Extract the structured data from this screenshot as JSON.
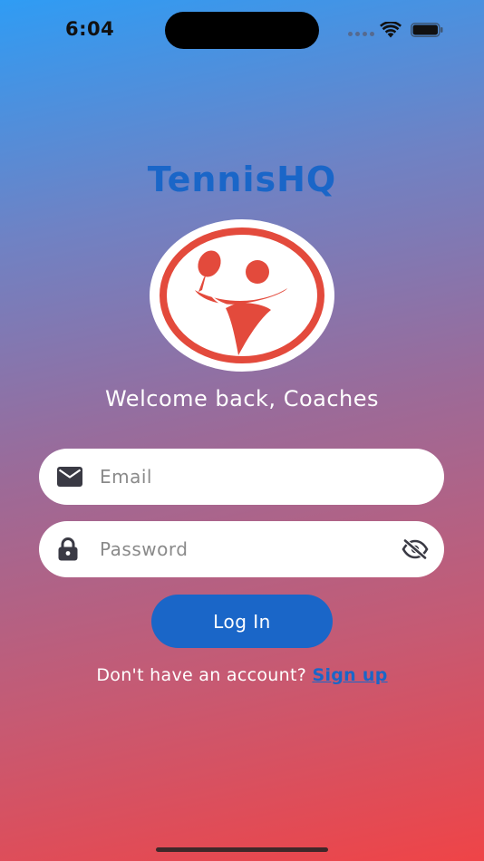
{
  "status_bar": {
    "time": "6:04"
  },
  "app": {
    "title": "TennisHQ",
    "welcome": "Welcome back, Coaches"
  },
  "form": {
    "email_placeholder": "Email",
    "email_value": "",
    "password_placeholder": "Password",
    "password_value": "",
    "login_label": "Log In",
    "signup_prompt": "Don't have an account?",
    "signup_link": "Sign up"
  },
  "colors": {
    "accent": "#1a66c8",
    "logo_red": "#e34a3c",
    "gradient_top": "#2f9cf4",
    "gradient_bottom": "#ef4447"
  },
  "icons": {
    "email": "envelope-icon",
    "password": "lock-icon",
    "visibility": "eye-off-icon"
  }
}
